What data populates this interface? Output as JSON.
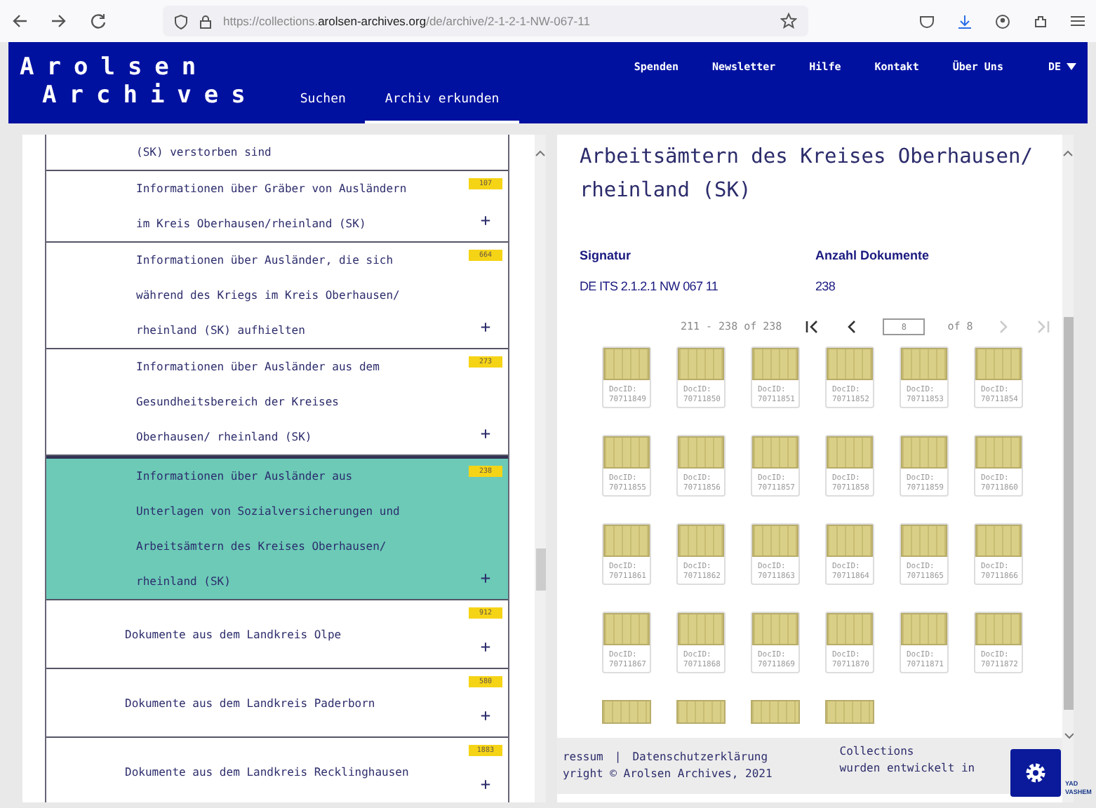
{
  "browser": {
    "url_host_prefix": "https://collections.",
    "url_domain": "arolsen-archives.org",
    "url_path": "/de/archive/2-1-2-1-NW-067-11"
  },
  "header": {
    "logo_lines": [
      "Arolsen",
      "Archives"
    ],
    "nav_left": [
      {
        "label": "Suchen",
        "selected": false
      },
      {
        "label": "Archiv erkunden",
        "selected": true
      }
    ],
    "nav_right": [
      "Spenden",
      "Newsletter",
      "Hilfe",
      "Kontakt",
      "Über Uns"
    ],
    "language": "DE"
  },
  "archive_list": [
    {
      "kind": "sub",
      "text": "(SK) verstorben sind",
      "selected": false
    },
    {
      "kind": "sub",
      "text": "Informationen über Gräber von Ausländern im Kreis Oberhausen/rheinland (SK)",
      "count": "107",
      "selected": false
    },
    {
      "kind": "sub",
      "text": "Informationen über Ausländer, die sich während des Kriegs im Kreis Oberhausen/ rheinland (SK) aufhielten",
      "count": "664",
      "selected": false
    },
    {
      "kind": "sub",
      "text": "Informationen über Ausländer aus dem Gesundheitsbereich der Kreises Oberhausen/ rheinland (SK)",
      "count": "273",
      "selected": false
    },
    {
      "kind": "sub",
      "text": "Informationen über Ausländer aus Unterlagen von Sozialversicherungen und Arbeitsämtern des Kreises Oberhausen/ rheinland (SK)",
      "count": "238",
      "selected": true
    },
    {
      "kind": "top",
      "text": "Dokumente aus dem Landkreis Olpe",
      "count": "912",
      "selected": false
    },
    {
      "kind": "top",
      "text": "Dokumente aus dem Landkreis Paderborn",
      "count": "580",
      "selected": false
    },
    {
      "kind": "top",
      "text": "Dokumente aus dem Landkreis Recklinghausen",
      "count": "1883",
      "selected": false
    }
  ],
  "detail": {
    "title": "Arbeitsämtern des Kreises Oberhausen/ rheinland (SK)",
    "fields": [
      {
        "label": "Signatur",
        "value": "DE ITS 2.1.2.1 NW 067 11"
      },
      {
        "label": "Anzahl Dokumente",
        "value": "238"
      }
    ],
    "pager": {
      "range": "211 - 238 of 238",
      "page": "8",
      "of": "of 8",
      "buttons": [
        {
          "kind": "first",
          "disabled": false
        },
        {
          "kind": "prev",
          "disabled": false
        },
        {
          "kind": "next",
          "disabled": true
        },
        {
          "kind": "last",
          "disabled": true
        }
      ]
    },
    "documents": [
      {
        "label": "DocID:",
        "id": "70711849"
      },
      {
        "label": "DocID:",
        "id": "70711850"
      },
      {
        "label": "DocID:",
        "id": "70711851"
      },
      {
        "label": "DocID:",
        "id": "70711852"
      },
      {
        "label": "DocID:",
        "id": "70711853"
      },
      {
        "label": "DocID:",
        "id": "70711854"
      },
      {
        "label": "DocID:",
        "id": "70711855"
      },
      {
        "label": "DocID:",
        "id": "70711856"
      },
      {
        "label": "DocID:",
        "id": "70711857"
      },
      {
        "label": "DocID:",
        "id": "70711858"
      },
      {
        "label": "DocID:",
        "id": "70711859"
      },
      {
        "label": "DocID:",
        "id": "70711860"
      },
      {
        "label": "DocID:",
        "id": "70711861"
      },
      {
        "label": "DocID:",
        "id": "70711862"
      },
      {
        "label": "DocID:",
        "id": "70711863"
      },
      {
        "label": "DocID:",
        "id": "70711864"
      },
      {
        "label": "DocID:",
        "id": "70711865"
      },
      {
        "label": "DocID:",
        "id": "70711866"
      },
      {
        "label": "DocID:",
        "id": "70711867"
      },
      {
        "label": "DocID:",
        "id": "70711868"
      },
      {
        "label": "DocID:",
        "id": "70711869"
      },
      {
        "label": "DocID:",
        "id": "70711870"
      },
      {
        "label": "DocID:",
        "id": "70711871"
      },
      {
        "label": "DocID:",
        "id": "70711872"
      },
      {
        "cut": true
      },
      {
        "cut": true
      },
      {
        "cut": true
      },
      {
        "cut": true
      }
    ]
  },
  "expand_label": "+",
  "footer": {
    "links": [
      "ressum",
      "Datenschutzerklärung"
    ],
    "separator": "|",
    "copyright": "yright © Arolsen Archives, 2021",
    "note_lines": [
      "Collections",
      "wurden entwickelt in"
    ],
    "partner": "YAD VASHEM"
  }
}
